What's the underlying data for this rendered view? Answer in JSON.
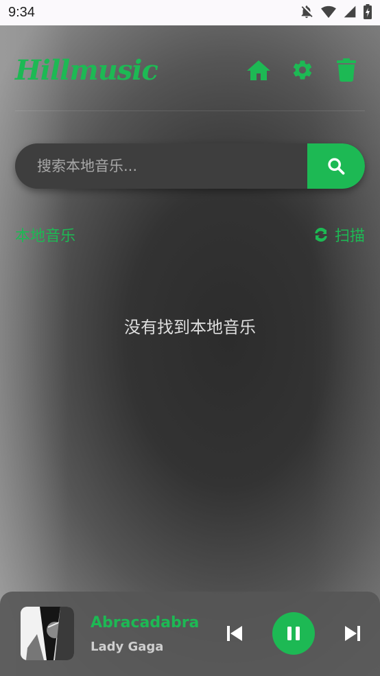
{
  "status_bar": {
    "time": "9:34",
    "icons": [
      "notifications-off-icon",
      "wifi-icon",
      "signal-icon",
      "battery-charging-icon"
    ]
  },
  "header": {
    "logo": "Hillmusic",
    "actions": [
      "home-icon",
      "settings-icon",
      "trash-icon"
    ]
  },
  "search": {
    "placeholder": "搜索本地音乐...",
    "value": ""
  },
  "section": {
    "title": "本地音乐",
    "scan_label": "扫描"
  },
  "empty_message": "没有找到本地音乐",
  "player": {
    "title": "Abracadabra",
    "artist": "Lady Gaga",
    "state": "playing"
  },
  "colors": {
    "accent": "#1db954",
    "player_bg": "#555555",
    "search_bg": "#3e3e3e"
  }
}
